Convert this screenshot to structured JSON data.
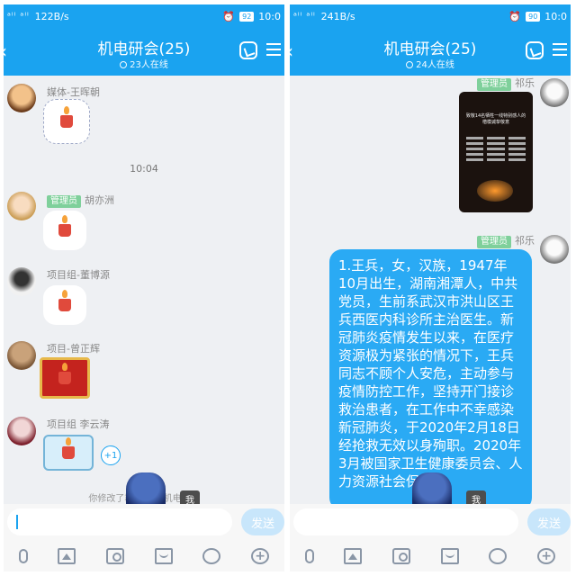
{
  "colors": {
    "accent": "#1aa3f0",
    "admin_badge": "#7fd09b",
    "candle": "#e04a3c"
  },
  "left": {
    "status": {
      "signal": "ᵃˡˡ ᵃˡˡ",
      "speed": "122B/s",
      "battery": "92",
      "time": "10:0"
    },
    "title": "机电研会(25)",
    "online": "23人在线",
    "messages": [
      {
        "sender": "媒体-王晖朝",
        "content": "candle-sticker"
      },
      {
        "timestamp": "10:04"
      },
      {
        "badge": "管理员",
        "sender": "胡亦洲",
        "content": "candle-emoji"
      },
      {
        "sender": "项目组-董博源",
        "content": "candle-emoji"
      },
      {
        "sender": "项目-曾正辉",
        "content": "candle-sticker"
      },
      {
        "sender": "项目组 李云涛",
        "content": "candle-sticker",
        "plus": "+1"
      }
    ],
    "notice": "你修改了群名片为 机电研会",
    "me_tag": "我",
    "send": "发送"
  },
  "right": {
    "status": {
      "signal": "ᵃˡˡ ᵃˡˡ",
      "speed": "241B/s",
      "battery": "90",
      "time": "10:0"
    },
    "title": "机电研会(25)",
    "online": "24人在线",
    "badge1": "管理员",
    "sender1": "祁乐",
    "poster_title": "致敬14名牺牲一线特别感人的楷模诚挚敬意",
    "badge2": "管理员",
    "sender2": "祁乐",
    "text": "1.王兵，女，汉族，1947年10月出生，湖南湘潭人，中共党员，生前系武汉市洪山区王兵西医内科诊所主治医生。新冠肺炎疫情发生以来，在医疗资源极为紧张的情况下，王兵同志不顾个人安危，主动参与疫情防控工作，坚持开门接诊救治患者，在工作中不幸感染新冠肺炎，于2020年2月18日经抢救无效以身殉职。2020年3月被国家卫生健康委员会、人力资源社会保障",
    "me_tag": "我",
    "send": "发送"
  }
}
